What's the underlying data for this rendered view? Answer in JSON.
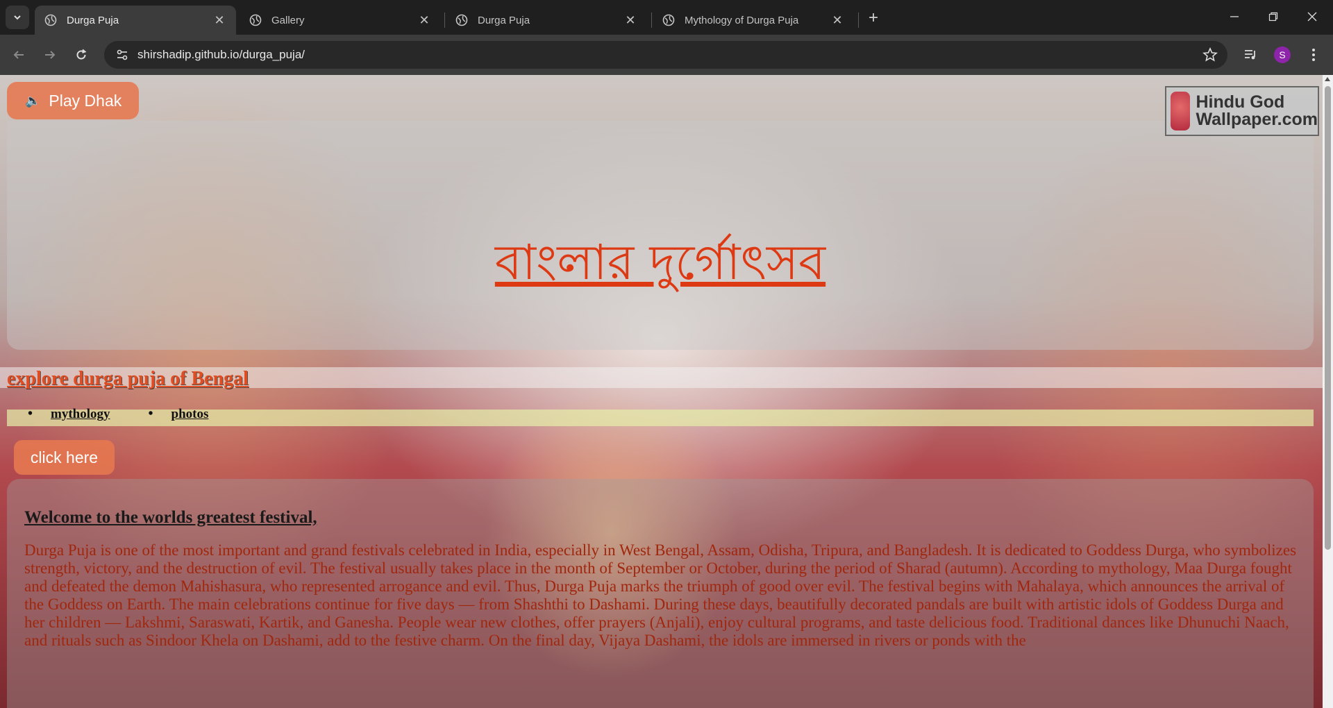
{
  "browser": {
    "tabs": [
      {
        "title": "Durga Puja",
        "active": true
      },
      {
        "title": "Gallery",
        "active": false
      },
      {
        "title": "Durga Puja",
        "active": false
      },
      {
        "title": "Mythology of Durga Puja",
        "active": false
      }
    ],
    "url": "shirshadip.github.io/durga_puja/",
    "profile_initial": "S",
    "profile_color": "#8e24aa"
  },
  "page": {
    "play_button_label": "Play Dhak",
    "logo_text": "Hindu God Wallpaper.com",
    "hero_title": "বাংলার দুর্গোৎসব",
    "explore_link": "explore durga puja of Bengal",
    "nav_links": [
      "mythology",
      "photos"
    ],
    "click_button_label": "click here",
    "welcome_heading": "Welcome to the worlds greatest festival,",
    "intro_paragraph": "Durga Puja is one of the most important and grand festivals celebrated in India, especially in West Bengal, Assam, Odisha, Tripura, and Bangladesh. It is dedicated to Goddess Durga, who symbolizes strength, victory, and the destruction of evil. The festival usually takes place in the month of September or October, during the period of Sharad (autumn). According to mythology, Maa Durga fought and defeated the demon Mahishasura, who represented arrogance and evil. Thus, Durga Puja marks the triumph of good over evil. The festival begins with Mahalaya, which announces the arrival of the Goddess on Earth. The main celebrations continue for five days — from Shashthi to Dashami. During these days, beautifully decorated pandals are built with artistic idols of Goddess Durga and her children — Lakshmi, Saraswati, Kartik, and Ganesha. People wear new clothes, offer prayers (Anjali), enjoy cultural programs, and taste delicious food. Traditional dances like Dhunuchi Naach, and rituals such as Sindoor Khela on Dashami, add to the festive charm. On the final day, Vijaya Dashami, the idols are immersed in rivers or ponds with the"
  },
  "colors": {
    "accent_title": "#dd3a14",
    "button_bg": "#e67850",
    "paragraph_text": "#a0270e"
  }
}
